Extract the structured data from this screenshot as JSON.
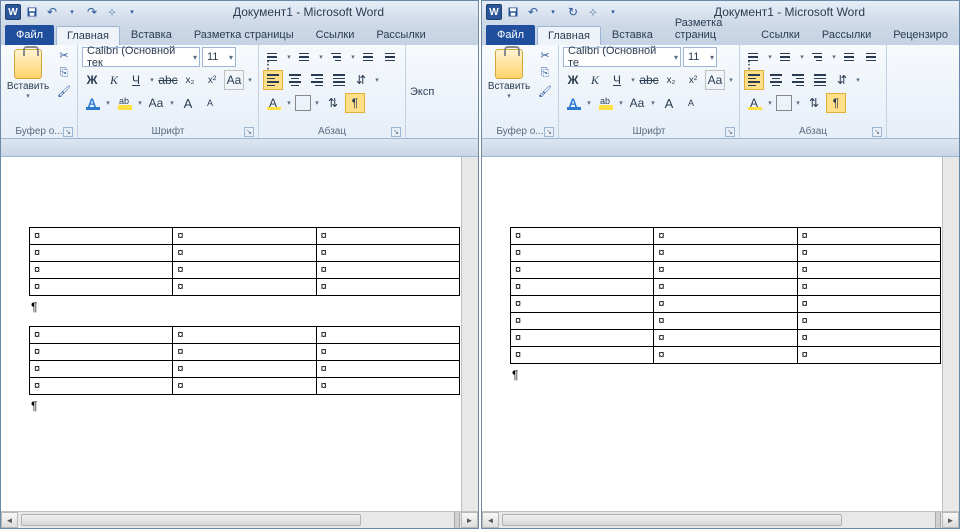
{
  "left": {
    "title": "Документ1 - Microsoft Word",
    "tabs": {
      "file": "Файл",
      "home": "Главная",
      "insert": "Вставка",
      "layout": "Разметка страницы",
      "refs": "Ссылки",
      "mail": "Рассылки"
    },
    "clipboard": {
      "paste": "Вставить",
      "group": "Буфер о..."
    },
    "font": {
      "name": "Calibri (Основной тек",
      "size": "11",
      "group": "Шрифт"
    },
    "para": {
      "group": "Абзац"
    },
    "truncated": "Эксп",
    "cellmark": "¤",
    "pmark": "¶",
    "tables": [
      {
        "rows": 4,
        "cols": 3
      },
      {
        "rows": 4,
        "cols": 3
      }
    ]
  },
  "right": {
    "title": "Документ1 - Microsoft Word",
    "tabs": {
      "file": "Файл",
      "home": "Главная",
      "insert": "Вставка",
      "layout": "Разметка страниц",
      "refs": "Ссылки",
      "mail": "Рассылки",
      "review": "Рецензиро"
    },
    "clipboard": {
      "paste": "Вставить",
      "group": "Буфер о..."
    },
    "font": {
      "name": "Calibri (Основной те",
      "size": "11",
      "group": "Шрифт"
    },
    "para": {
      "group": "Абзац"
    },
    "cellmark": "¤",
    "pmark": "¶",
    "tables": [
      {
        "rows": 8,
        "cols": 3
      }
    ]
  }
}
